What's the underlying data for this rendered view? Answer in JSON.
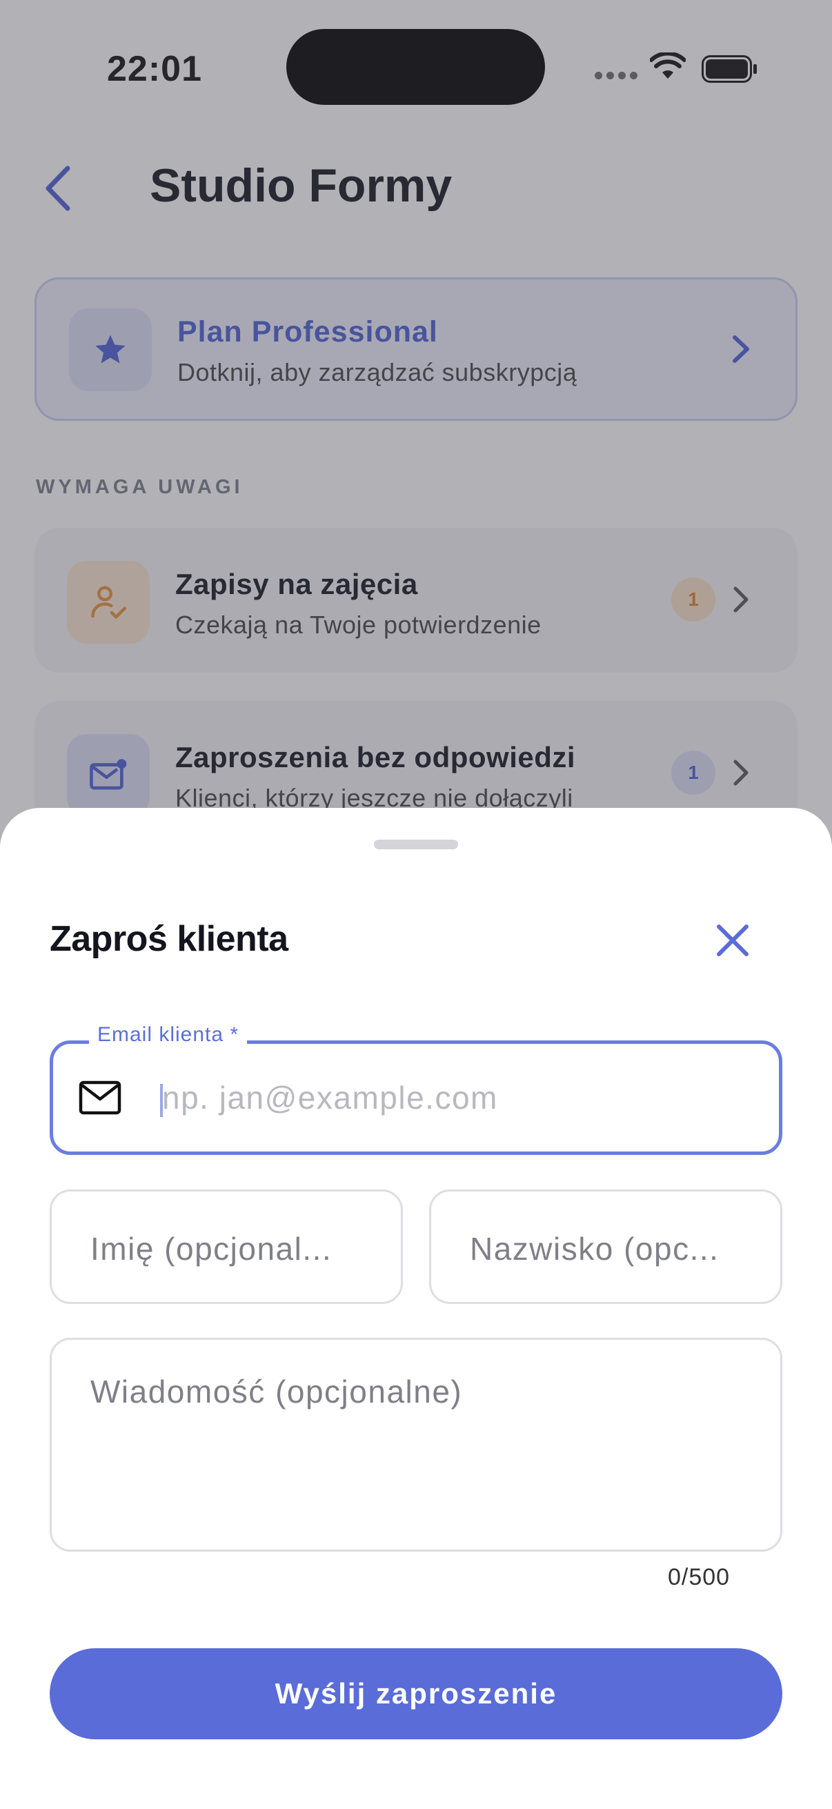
{
  "status_bar": {
    "time": "22:01"
  },
  "header": {
    "title": "Studio Formy"
  },
  "plan": {
    "title": "Plan Professional",
    "subtitle": "Dotknij, aby zarządzać subskrypcją",
    "icon": "star-icon"
  },
  "attention": {
    "section_label": "WYMAGA UWAGI",
    "items": [
      {
        "title": "Zapisy na zajęcia",
        "subtitle": "Czekają na Twoje potwierdzenie",
        "badge": "1",
        "icon": "user-check-icon",
        "accent": "#e8923a"
      },
      {
        "title": "Zaproszenia bez odpowiedzi",
        "subtitle": "Klienci, którzy jeszcze nie dołączyli",
        "badge": "1",
        "icon": "mail-notification-icon",
        "accent": "#4c5fd5"
      }
    ]
  },
  "invite_sheet": {
    "title": "Zaproś klienta",
    "email": {
      "label": "Email klienta *",
      "placeholder": "np. jan@example.com",
      "value": ""
    },
    "first_name": {
      "placeholder": "Imię (opcjonal...",
      "value": ""
    },
    "last_name": {
      "placeholder": "Nazwisko (opc...",
      "value": ""
    },
    "message": {
      "placeholder": "Wiadomość (opcjonalne)",
      "value": ""
    },
    "counter": "0/500",
    "submit_label": "Wyślij zaproszenie"
  },
  "colors": {
    "accent": "#5a6cd8",
    "focus_border": "#6a7de0",
    "text_primary": "#15151f"
  }
}
